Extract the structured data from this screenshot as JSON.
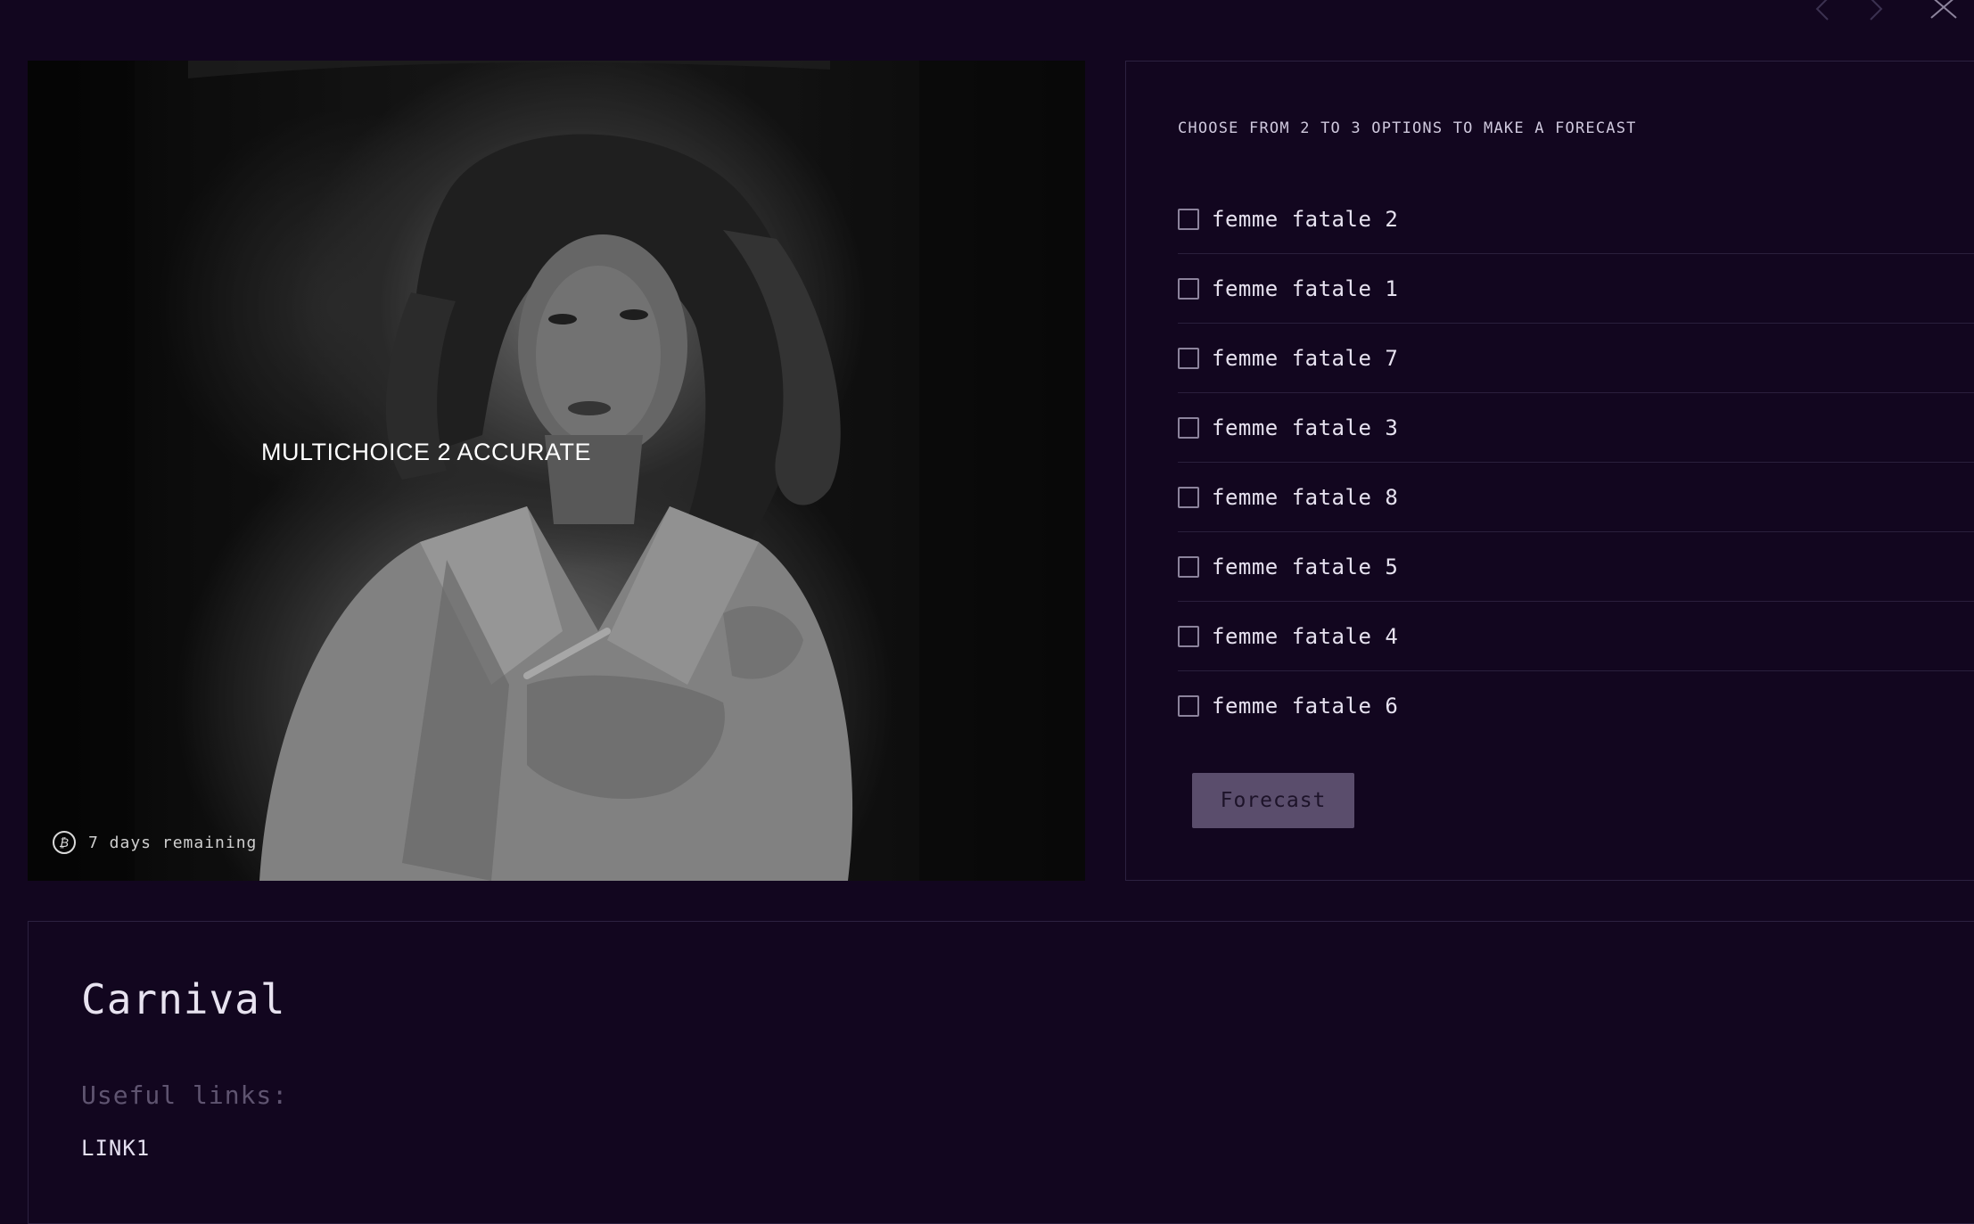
{
  "nav": {
    "prev_icon": "chevron-left-icon",
    "next_icon": "chevron-right-icon",
    "close_icon": "close-icon"
  },
  "card": {
    "title": "MULTICHOICE 2 ACCURATE",
    "remaining": "7 days remaining",
    "coin_glyph": "₿"
  },
  "forecast": {
    "instruction": "CHOOSE FROM 2 TO 3 OPTIONS TO MAKE A FORECAST",
    "options": [
      {
        "label": "femme fatale 2",
        "checked": false
      },
      {
        "label": "femme fatale 1",
        "checked": false
      },
      {
        "label": "femme fatale 7",
        "checked": false
      },
      {
        "label": "femme fatale 3",
        "checked": false
      },
      {
        "label": "femme fatale 8",
        "checked": false
      },
      {
        "label": "femme fatale 5",
        "checked": false
      },
      {
        "label": "femme fatale 4",
        "checked": false
      },
      {
        "label": "femme fatale 6",
        "checked": false
      }
    ],
    "button_label": "Forecast"
  },
  "description": {
    "title": "Carnival",
    "links_label": "Useful links:",
    "links": [
      "LINK1"
    ]
  },
  "colors": {
    "background": "#12061f",
    "border": "#2c2140",
    "button": "#5a4d6c",
    "muted_text": "#5f5470"
  }
}
